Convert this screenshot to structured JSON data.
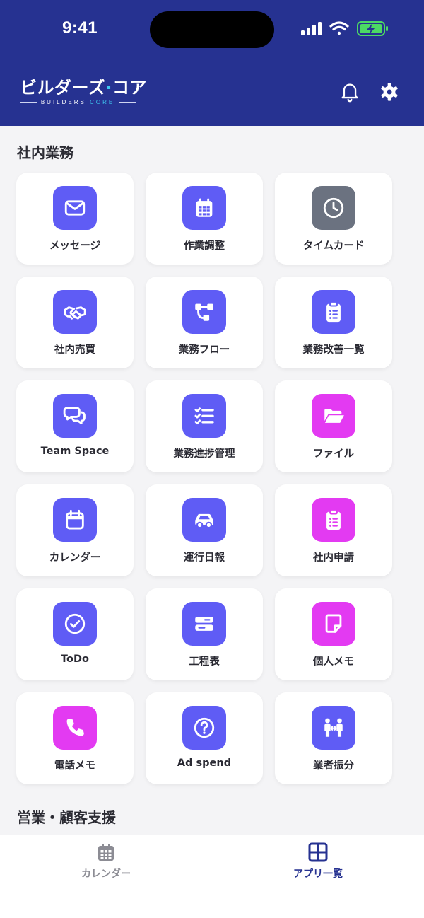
{
  "status": {
    "time": "9:41"
  },
  "header": {
    "logo_main": "ビルダーズ",
    "logo_dot": "·",
    "logo_tail": "コア",
    "logo_sub_a": "BUILDERS ",
    "logo_sub_b": "CORE"
  },
  "colors": {
    "header": "#263291",
    "purple": "#5f5cf5",
    "magenta": "#e33af2",
    "gray": "#6b7280"
  },
  "sections": [
    {
      "title": "社内業務"
    },
    {
      "title": "営業・顧客支援"
    }
  ],
  "apps": [
    {
      "label": "メッセージ",
      "icon": "mail-icon",
      "color": "purple"
    },
    {
      "label": "作業調整",
      "icon": "calendar-grid-icon",
      "color": "purple"
    },
    {
      "label": "タイムカード",
      "icon": "clock-icon",
      "color": "gray"
    },
    {
      "label": "社内売買",
      "icon": "handshake-icon",
      "color": "purple"
    },
    {
      "label": "業務フロー",
      "icon": "flow-icon",
      "color": "purple"
    },
    {
      "label": "業務改善一覧",
      "icon": "clipboard-list-icon",
      "color": "purple"
    },
    {
      "label": "Team Space",
      "icon": "chat-bubbles-icon",
      "color": "purple"
    },
    {
      "label": "業務進捗管理",
      "icon": "checklist-icon",
      "color": "purple"
    },
    {
      "label": "ファイル",
      "icon": "folder-open-icon",
      "color": "magenta"
    },
    {
      "label": "カレンダー",
      "icon": "calendar-icon",
      "color": "purple"
    },
    {
      "label": "運行日報",
      "icon": "car-icon",
      "color": "purple"
    },
    {
      "label": "社内申請",
      "icon": "clipboard-list-icon",
      "color": "magenta"
    },
    {
      "label": "ToDo",
      "icon": "check-circle-icon",
      "color": "purple"
    },
    {
      "label": "工程表",
      "icon": "schedule-bars-icon",
      "color": "purple"
    },
    {
      "label": "個人メモ",
      "icon": "note-icon",
      "color": "magenta"
    },
    {
      "label": "電話メモ",
      "icon": "phone-icon",
      "color": "magenta"
    },
    {
      "label": "Ad spend",
      "icon": "help-circle-icon",
      "color": "purple"
    },
    {
      "label": "業者振分",
      "icon": "people-exchange-icon",
      "color": "purple"
    }
  ],
  "tabs": [
    {
      "label": "カレンダー",
      "icon": "calendar-grid-icon",
      "active": false
    },
    {
      "label": "アプリ一覧",
      "icon": "app-grid-icon",
      "active": true
    }
  ]
}
